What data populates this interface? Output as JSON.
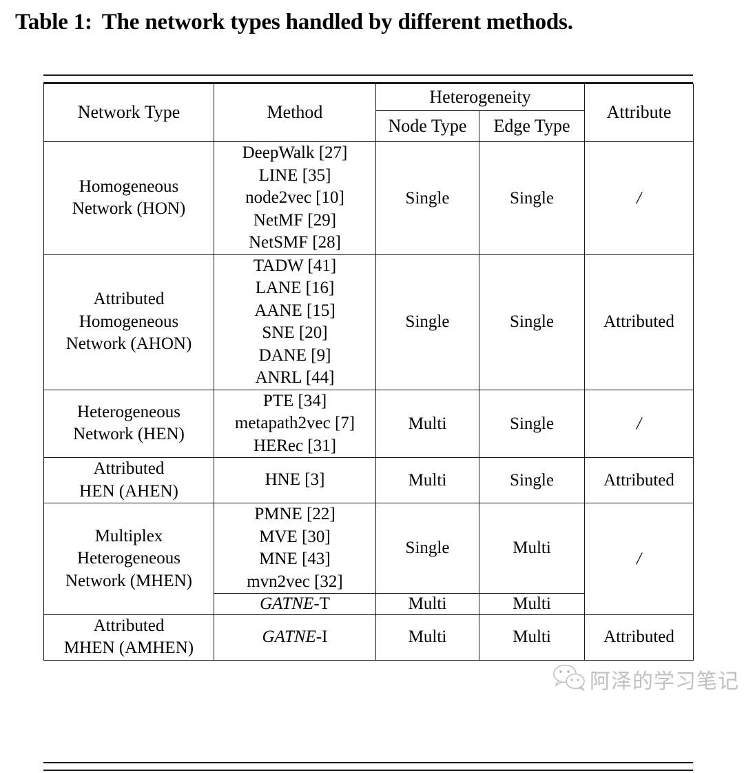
{
  "caption": {
    "label": "Table 1:",
    "text": "The network types handled by different methods."
  },
  "table": {
    "headers": {
      "network_type": "Network Type",
      "method": "Method",
      "heterogeneity": "Heterogeneity",
      "node_type": "Node Type",
      "edge_type": "Edge Type",
      "attribute": "Attribute"
    },
    "rows": [
      {
        "network_type": [
          "Homogeneous",
          "Network (HON)"
        ],
        "methods": [
          "DeepWalk [27]",
          "LINE [35]",
          "node2vec [10]",
          "NetMF [29]",
          "NetSMF [28]"
        ],
        "node_type": "Single",
        "edge_type": "Single",
        "attribute": "/"
      },
      {
        "network_type": [
          "Attributed",
          "Homogeneous",
          "Network (AHON)"
        ],
        "methods": [
          "TADW [41]",
          "LANE [16]",
          "AANE [15]",
          "SNE [20]",
          "DANE [9]",
          "ANRL [44]"
        ],
        "node_type": "Single",
        "edge_type": "Single",
        "attribute": "Attributed"
      },
      {
        "network_type": [
          "Heterogeneous",
          "Network (HEN)"
        ],
        "methods": [
          "PTE [34]",
          "metapath2vec [7]",
          "HERec [31]"
        ],
        "node_type": "Multi",
        "edge_type": "Single",
        "attribute": "/"
      },
      {
        "network_type": [
          "Attributed",
          "HEN (AHEN)"
        ],
        "methods": [
          "HNE [3]"
        ],
        "node_type": "Multi",
        "edge_type": "Single",
        "attribute": "Attributed"
      },
      {
        "network_type": [
          "Multiplex",
          "Heterogeneous",
          "Network (MHEN)"
        ],
        "methods": [
          "PMNE [22]",
          "MVE [30]",
          "MNE [43]",
          "mvn2vec [32]"
        ],
        "node_type": "Single",
        "edge_type": "Multi",
        "attribute": "/"
      },
      {
        "network_type": "",
        "methods_italic": "GATNE",
        "methods_suffix": "-T",
        "node_type": "Multi",
        "edge_type": "Multi",
        "attribute": ""
      },
      {
        "network_type": [
          "Attributed",
          "MHEN (AMHEN)"
        ],
        "methods_italic": "GATNE",
        "methods_suffix": "-I",
        "node_type": "Multi",
        "edge_type": "Multi",
        "attribute": "Attributed"
      }
    ]
  },
  "watermark": {
    "text": "阿泽的学习笔记",
    "icon": "wechat-icon"
  }
}
